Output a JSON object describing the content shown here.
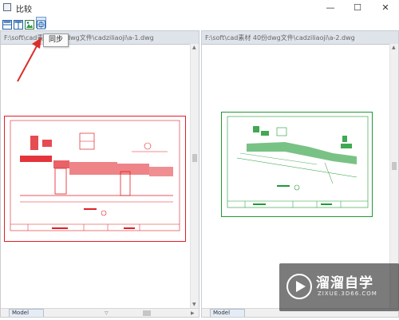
{
  "window": {
    "title": "比较",
    "minimize_glyph": "—",
    "maximize_glyph": "☐",
    "close_glyph": "✕"
  },
  "toolbar": {
    "buttons": [
      {
        "icon": "horizontal-layout-icon"
      },
      {
        "icon": "vertical-layout-icon"
      },
      {
        "icon": "image-export-icon"
      },
      {
        "icon": "sync-icon"
      }
    ],
    "tooltip": "同步"
  },
  "left_pane": {
    "path": "F:\\soft\\cad素材 40份dwg文件\\cadziliaoji\\a-1.dwg",
    "tab": "Model",
    "drawing_color": "#e01f26"
  },
  "right_pane": {
    "path": "F:\\soft\\cad素材 40份dwg文件\\cadziliaoji\\a-2.dwg",
    "tab": "Model",
    "drawing_color": "#1f9a34"
  },
  "watermark": {
    "title": "溜溜自学",
    "url": "ZIXUE.3D66.COM",
    "accent": "#ffffff"
  },
  "annotation_color": "#d9302a"
}
